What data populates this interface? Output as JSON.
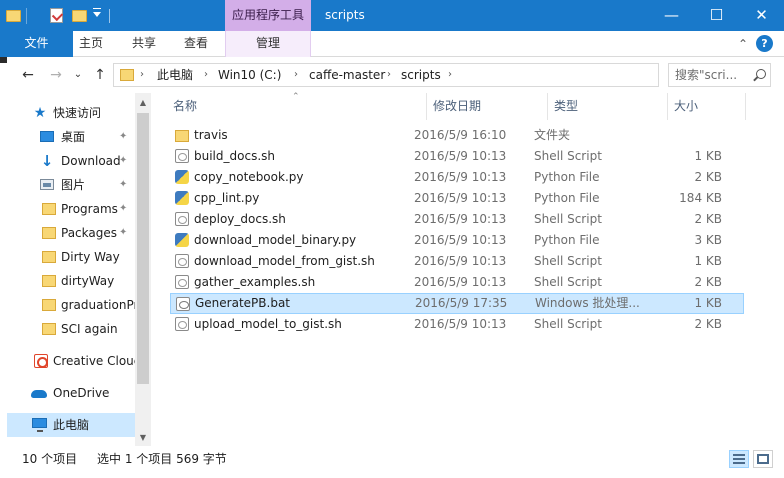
{
  "window": {
    "context_tab": "应用程序工具",
    "title": "scripts",
    "minimize": "—",
    "maximize": "☐",
    "close": "✕"
  },
  "ribbon": {
    "tabs": [
      "文件",
      "主页",
      "共享",
      "查看",
      "管理"
    ],
    "collapse": "⌃",
    "help": "?"
  },
  "address": {
    "back": "←",
    "forward": "→",
    "recent": "⌄",
    "up": "↑",
    "crumbs": [
      "此电脑",
      "Win10 (C:)",
      "caffe-master",
      "scripts"
    ],
    "separator": "›",
    "dropdown": "⌄",
    "refresh": "↻",
    "search_placeholder": "搜索\"scri..."
  },
  "nav": {
    "items": [
      {
        "label": "快速访问",
        "icon": "star-icon"
      },
      {
        "label": "桌面",
        "icon": "desktop-icon",
        "pinned": true
      },
      {
        "label": "Download",
        "icon": "download-icon",
        "pinned": true
      },
      {
        "label": "图片",
        "icon": "pictures-icon",
        "pinned": true
      },
      {
        "label": "Programs",
        "icon": "folder-icon",
        "pinned": true
      },
      {
        "label": "Packages",
        "icon": "folder-icon",
        "pinned": true
      },
      {
        "label": "Dirty Way",
        "icon": "folder-icon"
      },
      {
        "label": "dirtyWay",
        "icon": "folder-icon"
      },
      {
        "label": "graduationPr",
        "icon": "folder-icon"
      },
      {
        "label": "SCI again",
        "icon": "folder-icon"
      },
      {
        "label": "Creative Clouc",
        "icon": "creative-cloud-icon"
      },
      {
        "label": "OneDrive",
        "icon": "onedrive-icon"
      },
      {
        "label": "此电脑",
        "icon": "this-pc-icon"
      }
    ],
    "pin_glyph": "📌"
  },
  "columns": [
    "名称",
    "修改日期",
    "类型",
    "大小"
  ],
  "files": [
    {
      "name": "travis",
      "date": "2016/5/9 16:10",
      "type": "文件夹",
      "size": "",
      "icon": "folder-icon"
    },
    {
      "name": "build_docs.sh",
      "date": "2016/5/9 10:13",
      "type": "Shell Script",
      "size": "1 KB",
      "icon": "shell-script-icon"
    },
    {
      "name": "copy_notebook.py",
      "date": "2016/5/9 10:13",
      "type": "Python File",
      "size": "2 KB",
      "icon": "python-file-icon"
    },
    {
      "name": "cpp_lint.py",
      "date": "2016/5/9 10:13",
      "type": "Python File",
      "size": "184 KB",
      "icon": "python-file-icon"
    },
    {
      "name": "deploy_docs.sh",
      "date": "2016/5/9 10:13",
      "type": "Shell Script",
      "size": "2 KB",
      "icon": "shell-script-icon"
    },
    {
      "name": "download_model_binary.py",
      "date": "2016/5/9 10:13",
      "type": "Python File",
      "size": "3 KB",
      "icon": "python-file-icon"
    },
    {
      "name": "download_model_from_gist.sh",
      "date": "2016/5/9 10:13",
      "type": "Shell Script",
      "size": "1 KB",
      "icon": "shell-script-icon"
    },
    {
      "name": "gather_examples.sh",
      "date": "2016/5/9 10:13",
      "type": "Shell Script",
      "size": "2 KB",
      "icon": "shell-script-icon"
    },
    {
      "name": "GeneratePB.bat",
      "date": "2016/5/9 17:35",
      "type": "Windows 批处理...",
      "size": "1 KB",
      "icon": "batch-file-icon",
      "selected": true
    },
    {
      "name": "upload_model_to_gist.sh",
      "date": "2016/5/9 10:13",
      "type": "Shell Script",
      "size": "2 KB",
      "icon": "shell-script-icon"
    }
  ],
  "status": {
    "count": "10 个项目",
    "selection": "选中 1 个项目  569 字节"
  }
}
